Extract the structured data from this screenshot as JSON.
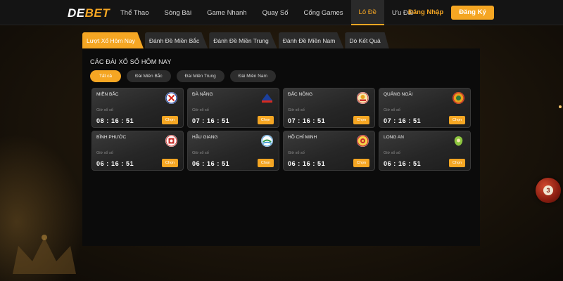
{
  "header": {
    "logo_prefix": "DE",
    "logo_suffix": "BET",
    "nav": [
      "Thể Thao",
      "Sòng Bài",
      "Game Nhanh",
      "Quay Số",
      "Cổng Games",
      "Lô Đề",
      "Ưu Đãi"
    ],
    "active_nav_index": 5,
    "login_label": "Đăng Nhập",
    "register_label": "Đăng Ký"
  },
  "tabs": [
    "Lượt Xổ Hôm Nay",
    "Đánh Đề Miền Bắc",
    "Đánh Đề Miền Trung",
    "Đánh Đề Miền Nam",
    "Dò Kết Quả"
  ],
  "active_tab_index": 0,
  "panel": {
    "title": "CÁC ĐÀI XỔ SỐ HÔM NAY",
    "filters": [
      "Tất cả",
      "Đài Miền Bắc",
      "Đài Miền Trung",
      "Đài Miền Nam"
    ],
    "active_filter_index": 0
  },
  "cards": [
    {
      "name": "MIỀN BẮC",
      "sub": "Giờ xổ số",
      "time": "08 : 16 : 51",
      "button": "Chọn",
      "logo": "mien-bac-logo"
    },
    {
      "name": "ĐÀ NẴNG",
      "sub": "Giờ xổ số",
      "time": "07 : 16 : 51",
      "button": "Chọn",
      "logo": "da-nang-logo"
    },
    {
      "name": "ĐẮC NÔNG",
      "sub": "Giờ xổ số",
      "time": "07 : 16 : 51",
      "button": "Chọn",
      "logo": "dac-nong-logo"
    },
    {
      "name": "QUẢNG NGÃI",
      "sub": "Giờ xổ số",
      "time": "07 : 16 : 51",
      "button": "Chọn",
      "logo": "quang-ngai-logo"
    },
    {
      "name": "BÌNH PHƯỚC",
      "sub": "Giờ xổ số",
      "time": "06 : 16 : 51",
      "button": "Chọn",
      "logo": "binh-phuoc-logo"
    },
    {
      "name": "HẬU GIANG",
      "sub": "Giờ xổ số",
      "time": "06 : 16 : 51",
      "button": "Chọn",
      "logo": "hau-giang-logo"
    },
    {
      "name": "HỒ CHÍ MINH",
      "sub": "Giờ xổ số",
      "time": "06 : 16 : 51",
      "button": "Chọn",
      "logo": "ho-chi-minh-logo"
    },
    {
      "name": "LONG AN",
      "sub": "Giờ xổ số",
      "time": "06 : 16 : 51",
      "button": "Chọn",
      "logo": "long-an-logo"
    }
  ],
  "colors": {
    "accent": "#f5a623",
    "header_bg": "#141414",
    "panel_bg": "#0b0b0b",
    "card_bg": "#2a2a2a"
  }
}
